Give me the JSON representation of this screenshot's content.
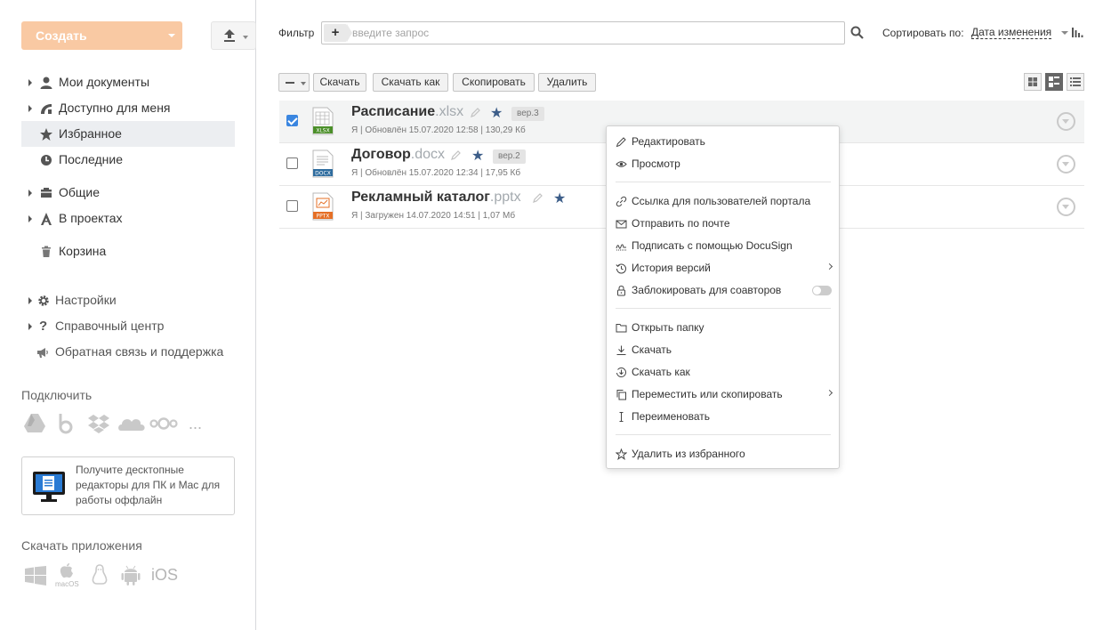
{
  "sidebar": {
    "create_label": "Создать",
    "nav": [
      {
        "label": "Мои документы",
        "icon": "user-icon"
      },
      {
        "label": "Доступно для меня",
        "icon": "share-icon"
      },
      {
        "label": "Избранное",
        "icon": "star-icon"
      },
      {
        "label": "Последние",
        "icon": "clock-icon"
      },
      {
        "label": "Общие",
        "icon": "folder-common-icon"
      },
      {
        "label": "В проектах",
        "icon": "projects-icon"
      },
      {
        "label": "Корзина",
        "icon": "trash-icon"
      }
    ],
    "secondary": [
      {
        "label": "Настройки",
        "icon": "gear-icon"
      },
      {
        "label": "Справочный центр",
        "icon": "help-icon"
      },
      {
        "label": "Обратная связь и поддержка",
        "icon": "megaphone-icon"
      }
    ],
    "connect_title": "Подключить",
    "connect_more": "...",
    "promo_text": "Получите десктопные редакторы для ПК и Mac для работы оффлайн",
    "apps_title": "Скачать приложения",
    "apps_macos": "macOS",
    "apps_ios": "iOS"
  },
  "filter": {
    "label": "Фильтр",
    "plus": "+",
    "placeholder": "введите запрос"
  },
  "sort": {
    "label": "Сортировать по:",
    "value": "Дата изменения"
  },
  "toolbar": {
    "download": "Скачать",
    "download_as": "Скачать как",
    "copy": "Скопировать",
    "delete": "Удалить"
  },
  "files": [
    {
      "name": "Расписание",
      "ext": ".xlsx",
      "version": "вер.3",
      "meta": "Я | Обновлён 15.07.2020 12:58 | 130,29 Кб",
      "type_label": "XLSX",
      "color": "#4b8f29",
      "selected": true
    },
    {
      "name": "Договор",
      "ext": ".docx",
      "version": "вер.2",
      "meta": "Я | Обновлён 15.07.2020 12:34 | 17,95 Кб",
      "type_label": "DOCX",
      "color": "#2e6c9e",
      "selected": false
    },
    {
      "name": "Рекламный каталог",
      "ext": ".pptx",
      "version": "",
      "meta": "Я | Загружен 14.07.2020 14:51 | 1,07 Мб",
      "type_label": "PPTX",
      "color": "#e56f26",
      "selected": false
    }
  ],
  "context_menu": {
    "edit": "Редактировать",
    "preview": "Просмотр",
    "portal_link": "Ссылка для пользователей портала",
    "send_mail": "Отправить по почте",
    "docusign": "Подписать с помощью DocuSign",
    "versions": "История версий",
    "lock": "Заблокировать для соавторов",
    "open_folder": "Открыть папку",
    "download": "Скачать",
    "download_as": "Скачать как",
    "move_copy": "Переместить или скопировать",
    "rename": "Переименовать",
    "unfavorite": "Удалить из избранного"
  },
  "colors": {
    "accent": "#3d5e89",
    "create_button": "#f9c9a3",
    "selected_row": "#f3f4f4"
  }
}
